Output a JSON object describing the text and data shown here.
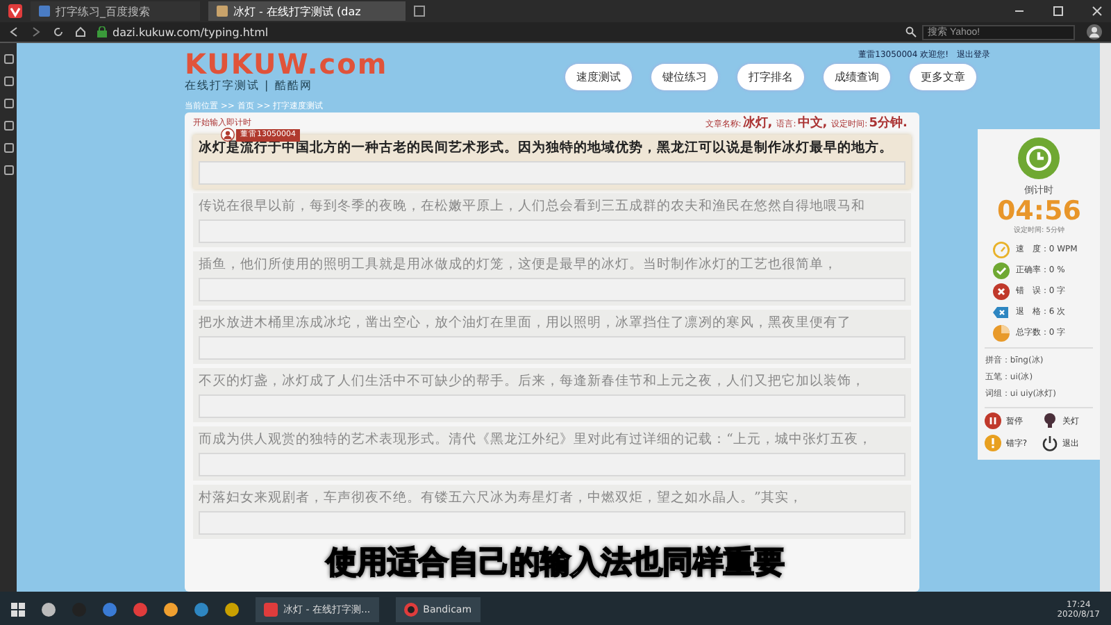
{
  "browser": {
    "tabs": [
      {
        "title": "打字练习_百度搜索",
        "selected": false
      },
      {
        "title": "冰灯 - 在线打字测试 (daz",
        "selected": true
      }
    ],
    "url": "dazi.kukuw.com/typing.html",
    "search": {
      "placeholder": "搜索 Yahoo!"
    }
  },
  "header": {
    "logo": "KUKUW.com",
    "slogan": "在线打字测试 | 酷酷网",
    "user_line": "董雷13050004 欢迎您!",
    "logout": "退出登录",
    "nav": [
      "速度测试",
      "键位练习",
      "打字排名",
      "成绩查询",
      "更多文章"
    ],
    "breadcrumb": "当前位置 >> 首页 >> 打字速度测试"
  },
  "test": {
    "hint": "开始输入即计时",
    "user_badge": "董雷13050004",
    "info": [
      {
        "label": "文章名称:",
        "value": "冰灯,"
      },
      {
        "label": "语言:",
        "value": "中文,"
      },
      {
        "label": "设定时间:",
        "value": "5分钟."
      }
    ],
    "rows": [
      {
        "text": "冰灯是流行于中国北方的一种古老的民间艺术形式。因为独特的地域优势，黑龙江可以说是制作冰灯最早的地方。",
        "active": true
      },
      {
        "text": "传说在很早以前，每到冬季的夜晚，在松嫩平原上，人们总会看到三五成群的农夫和渔民在悠然自得地喂马和",
        "active": false
      },
      {
        "text": "插鱼，他们所使用的照明工具就是用冰做成的灯笼，这便是最早的冰灯。当时制作冰灯的工艺也很简单，",
        "active": false
      },
      {
        "text": "把水放进木桶里冻成冰坨，凿出空心，放个油灯在里面，用以照明，冰罩挡住了凛冽的寒风，黑夜里便有了",
        "active": false
      },
      {
        "text": "不灭的灯盏，冰灯成了人们生活中不可缺少的帮手。后来，每逢新春佳节和上元之夜，人们又把它加以装饰，",
        "active": false
      },
      {
        "text": "而成为供人观赏的独特的艺术表现形式。清代《黑龙江外纪》里对此有过详细的记载：“上元，城中张灯五夜，",
        "active": false
      },
      {
        "text": "村落妇女来观剧者，车声彻夜不绝。有镂五六尺冰为寿星灯者，中燃双炬，望之如水晶人。”其实，",
        "active": false
      }
    ]
  },
  "sidebar": {
    "timer_label": "倒计时",
    "time": "04:56",
    "set_time": "设定时间: 5分钟",
    "stats": [
      {
        "kind": "speed",
        "label": "速　度：",
        "value": "0 WPM"
      },
      {
        "kind": "accuracy",
        "label": "正确率：",
        "value": "0 %"
      },
      {
        "kind": "errors",
        "label": "错　误：",
        "value": "0 字"
      },
      {
        "kind": "backspace",
        "label": "退　格：",
        "value": "6 次"
      },
      {
        "kind": "total",
        "label": "总字数：",
        "value": "0 字"
      }
    ],
    "hints": [
      "拼音：bīng(冰)",
      "五笔：ui(冰)",
      "词组：ui uiy(冰灯)"
    ],
    "actions": [
      {
        "kind": "pause",
        "label": "暂停"
      },
      {
        "kind": "light",
        "label": "关灯"
      },
      {
        "kind": "typo",
        "label": "错字?"
      },
      {
        "kind": "exit",
        "label": "退出"
      }
    ]
  },
  "subtitle": "使用适合自己的输入法也同样重要",
  "taskbar": {
    "apps": [
      {
        "kind": "browser",
        "label": "冰灯 - 在线打字测..."
      },
      {
        "kind": "record",
        "label": "Bandicam"
      }
    ],
    "time": "17:24",
    "date": "2020/8/17"
  }
}
